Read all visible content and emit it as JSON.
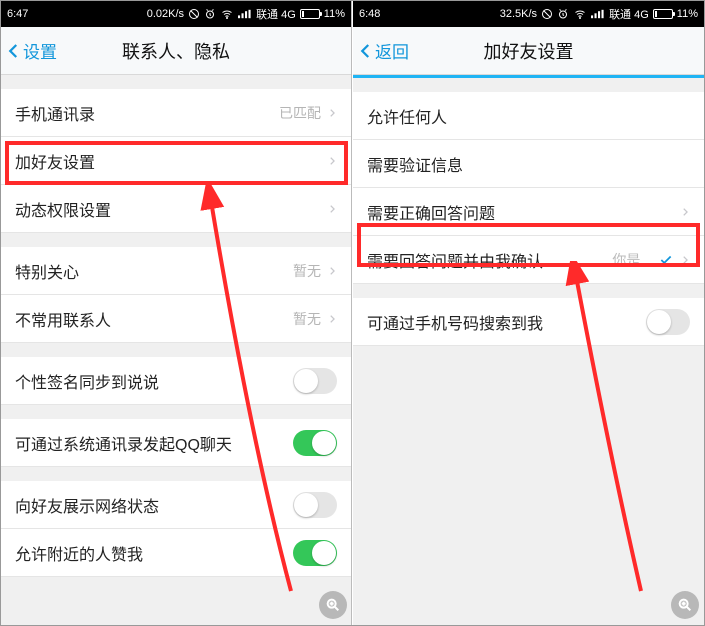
{
  "left": {
    "status": {
      "time": "6:47",
      "speed": "0.02K/s",
      "carrier": "联通 4G",
      "battery": "11%"
    },
    "nav": {
      "back": "设置",
      "title": "联系人、隐私"
    },
    "rows": {
      "contacts": {
        "label": "手机通讯录",
        "sub": "已匹配"
      },
      "addfriend": {
        "label": "加好友设置"
      },
      "dyn": {
        "label": "动态权限设置"
      },
      "special": {
        "label": "特别关心",
        "sub": "暂无"
      },
      "uncommon": {
        "label": "不常用联系人",
        "sub": "暂无"
      },
      "sig": {
        "label": "个性签名同步到说说"
      },
      "sys": {
        "label": "可通过系统通讯录发起QQ聊天"
      },
      "net": {
        "label": "向好友展示网络状态"
      },
      "nearby": {
        "label": "允许附近的人赞我"
      }
    }
  },
  "right": {
    "status": {
      "time": "6:48",
      "speed": "32.5K/s",
      "carrier": "联通 4G",
      "battery": "11%"
    },
    "nav": {
      "back": "返回",
      "title": "加好友设置"
    },
    "rows": {
      "any": {
        "label": "允许任何人"
      },
      "verify": {
        "label": "需要验证信息"
      },
      "answer": {
        "label": "需要正确回答问题"
      },
      "confirm": {
        "label": "需要回答问题并由我确认",
        "sub": "你是..."
      },
      "phone": {
        "label": "可通过手机号码搜索到我"
      }
    }
  }
}
